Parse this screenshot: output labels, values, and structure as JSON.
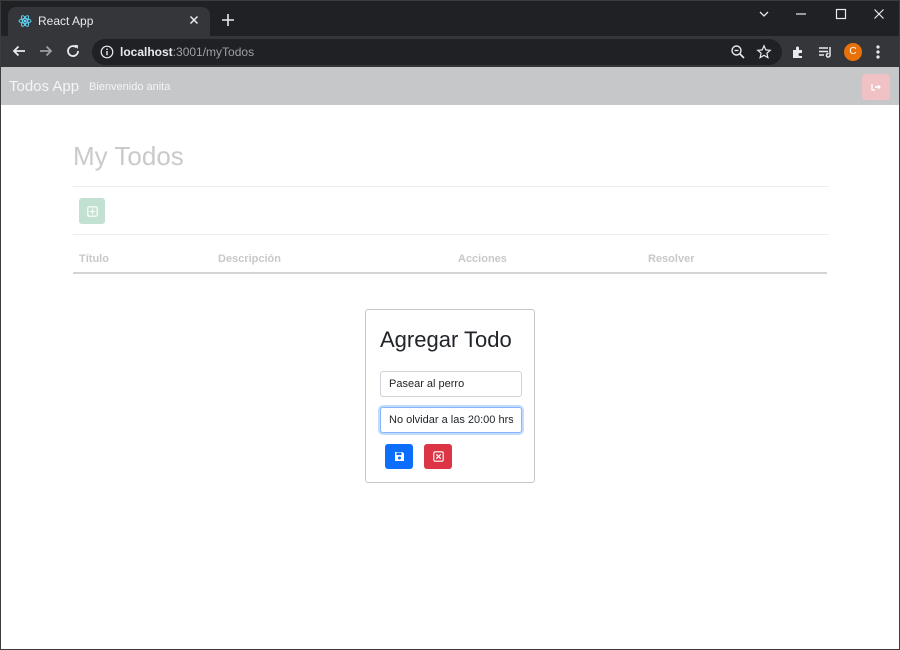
{
  "browser": {
    "tab_title": "React App",
    "url_host": "localhost",
    "url_rest": ":3001/myTodos",
    "profile_initial": "C"
  },
  "navbar": {
    "brand": "Todos App",
    "welcome": "Bienvenido anita"
  },
  "page": {
    "title": "My Todos",
    "table_headers": [
      "Título",
      "Descripción",
      "Acciones",
      "Resolver"
    ]
  },
  "modal": {
    "title": "Agregar Todo",
    "title_input_value": "Pasear al perro",
    "description_input_value": "No olvidar a las 20:00 hrs"
  },
  "colors": {
    "primary": "#0d6efd",
    "danger": "#dc3545",
    "success": "#198754",
    "profile": "#e8710a"
  }
}
